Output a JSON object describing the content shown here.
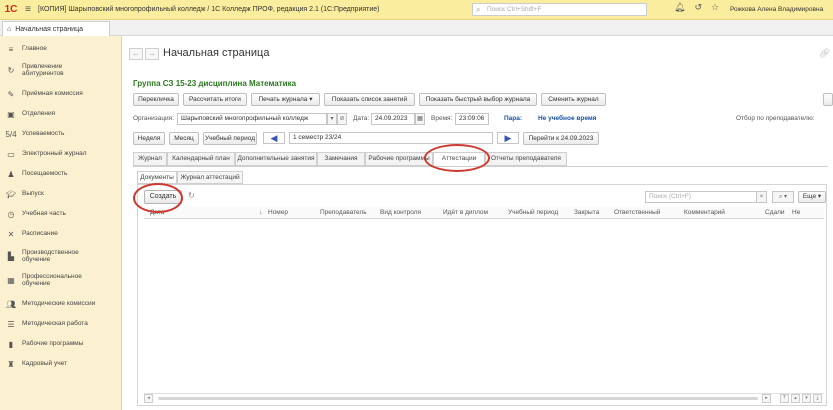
{
  "titlebar": {
    "title": "[КОПИЯ] Шарыповский многопрофильный колледж / 1С Колледж ПРОФ, редакция 2.1  (1С:Предприятие)",
    "search_placeholder": "Поиск Ctrl+Shift+F",
    "user": "Рожкова Алена Владимировна"
  },
  "home_tab": {
    "label": "Начальная страница"
  },
  "sidebar": {
    "items": [
      {
        "label": "Главное",
        "icon": "menu-icon"
      },
      {
        "label": "Привлечение абитуриентов",
        "icon": "recruit-icon"
      },
      {
        "label": "Приёмная комиссия",
        "icon": "admission-icon"
      },
      {
        "label": "Отделения",
        "icon": "department-icon"
      },
      {
        "label": "Успеваемость",
        "icon": "grades-icon"
      },
      {
        "label": "Электронный журнал",
        "icon": "journal-icon"
      },
      {
        "label": "Посещаемость",
        "icon": "attendance-icon"
      },
      {
        "label": "Выпуск",
        "icon": "graduation-icon"
      },
      {
        "label": "Учебная часть",
        "icon": "clock-icon"
      },
      {
        "label": "Расписание",
        "icon": "schedule-icon"
      },
      {
        "label": "Производственное обучение",
        "icon": "factory-icon"
      },
      {
        "label": "Профессиональное обучение",
        "icon": "training-icon"
      },
      {
        "label": "Методические комиссии",
        "icon": "people-icon"
      },
      {
        "label": "Методическая работа",
        "icon": "methodic-icon"
      },
      {
        "label": "Рабочие программы",
        "icon": "document-icon"
      },
      {
        "label": "Кадровый учет",
        "icon": "hr-icon"
      }
    ]
  },
  "page": {
    "title": "Начальная страница",
    "group_title": "Группа СЗ 15-23 дисциплина Математика"
  },
  "toolbar": {
    "b1": "Перекличка",
    "b2": "Рассчитать итоги",
    "b3": "Печать журнала",
    "b4": "Показать список занятий",
    "b5": "Показать быстрый выбор журнала",
    "b6": "Сменить журнал"
  },
  "org": {
    "label": "Организация:",
    "value": "Шарыповский многопрофильный колледж",
    "date_label": "Дата:",
    "date_value": "24.09.2023",
    "time_label": "Время:",
    "time_value": "23:09:06",
    "para_label": "Пара:",
    "para_value": "Не учебное время",
    "filter_label": "Отбор по преподавателю:"
  },
  "period": {
    "week": "Неделя",
    "month": "Месяц",
    "study_period": "Учебный период",
    "semester": "1 семестр 23/24",
    "goto": "Перейти к 24.09.2023"
  },
  "tabs": [
    "Журнал",
    "Календарный план",
    "Дополнительные занятия",
    "Замечания",
    "Рабочие программы",
    "Аттестации",
    "Отчеты преподавателя"
  ],
  "subtabs": [
    "Документы",
    "Журнал аттестаций"
  ],
  "list": {
    "create": "Создать",
    "search_placeholder": "Поиск (Ctrl+F)",
    "more": "Еще",
    "columns": [
      "Дата",
      "Номер",
      "Преподаватель",
      "Вид контроля",
      "Идёт в диплом",
      "Учебный период",
      "Закрыта",
      "Ответственный",
      "Комментарий",
      "Сдали",
      "Не"
    ]
  },
  "colors": {
    "accent_green": "#2b7a1f",
    "highlight_red": "#cc3a2f",
    "sidebar_bg": "#fbf1d0",
    "titlebar_bg": "#fbed9e"
  }
}
